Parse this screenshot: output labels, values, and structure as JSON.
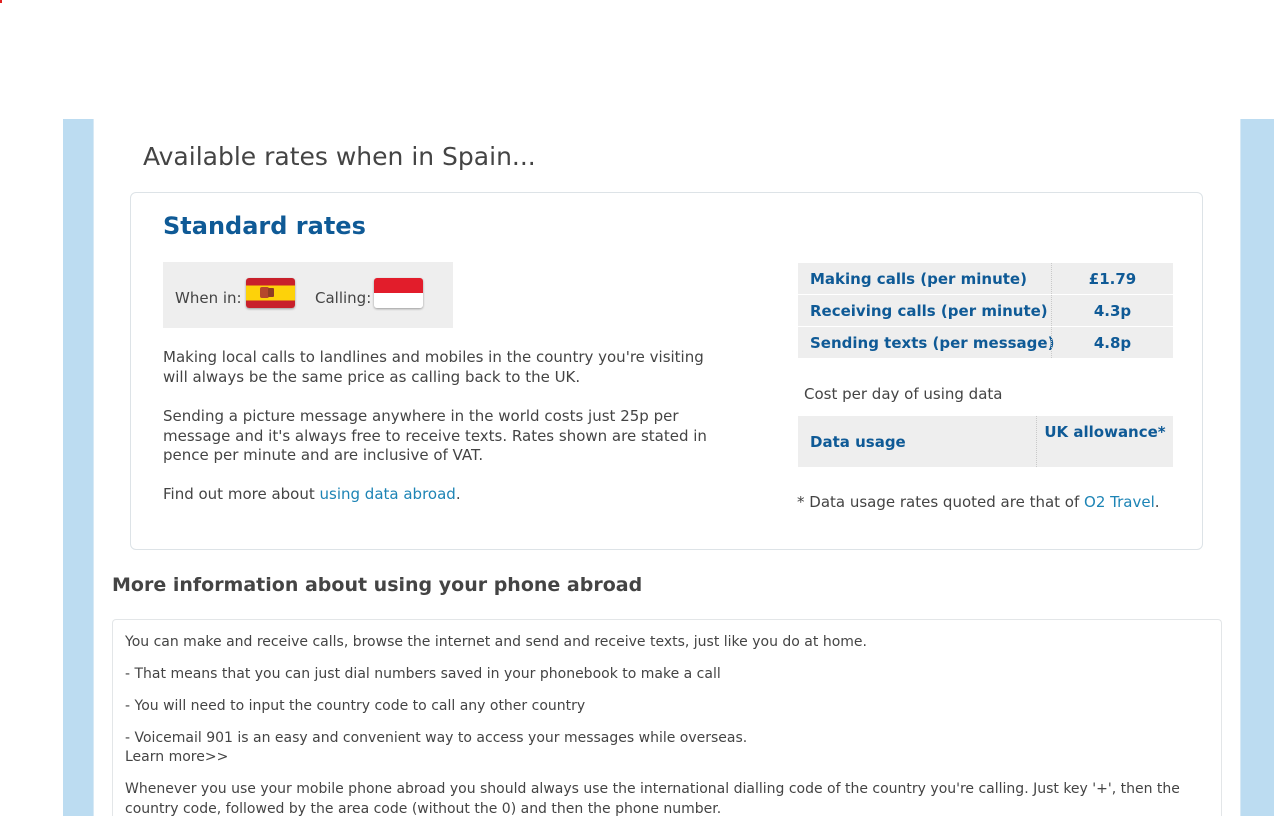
{
  "page": {
    "title": "Available rates when in Spain..."
  },
  "rates": {
    "heading": "Standard rates",
    "when_in_label": "When in:",
    "calling_label": "Calling:",
    "para1": "Making local calls to landlines and mobiles in the country you're visiting will always be the same price as calling back to the UK.",
    "para2": "Sending a picture message anywhere in the world costs just 25p per message and it's always free to receive texts. Rates shown are stated in pence per minute and are inclusive of VAT.",
    "para3_prefix": "Find out more about ",
    "para3_link": "using data abroad",
    "para3_suffix": ".",
    "table": [
      {
        "label": "Making calls (per minute)",
        "value": "£1.79"
      },
      {
        "label": "Receiving calls (per minute)",
        "value": "4.3p"
      },
      {
        "label": "Sending texts (per message)",
        "value": "4.8p"
      }
    ],
    "data_caption": "Cost per day of using data",
    "data_row": {
      "label": "Data usage",
      "value": "UK allowance*"
    },
    "footnote_prefix": "* Data usage rates quoted are that of ",
    "footnote_link": "O2 Travel",
    "footnote_suffix": "."
  },
  "more": {
    "title": "More information about using your phone abroad",
    "line1": "You can make and receive calls, browse the internet and send and receive texts, just like you do at home.",
    "line2": "- That means that you can just dial numbers saved in your phonebook to make a call",
    "line3": "- You will need to input the country code to call any other country",
    "line4": "- Voicemail 901 is an easy and convenient way to access your messages while overseas.",
    "learn_more": "Learn more>>",
    "line5": "Whenever you use your mobile phone abroad you should always use the international dialling code of the country you're calling. Just key '+', then the country code, followed by the area code (without the 0) and then the phone number."
  },
  "colors": {
    "heading_blue": "#0f5a96",
    "link_blue": "#1d84b5",
    "rail_blue": "#bcdcf1",
    "panel_grey": "#eeeeee"
  },
  "icons": {
    "when_in_flag": "spain-flag-icon",
    "calling_flag": "indonesia-flag-icon"
  }
}
